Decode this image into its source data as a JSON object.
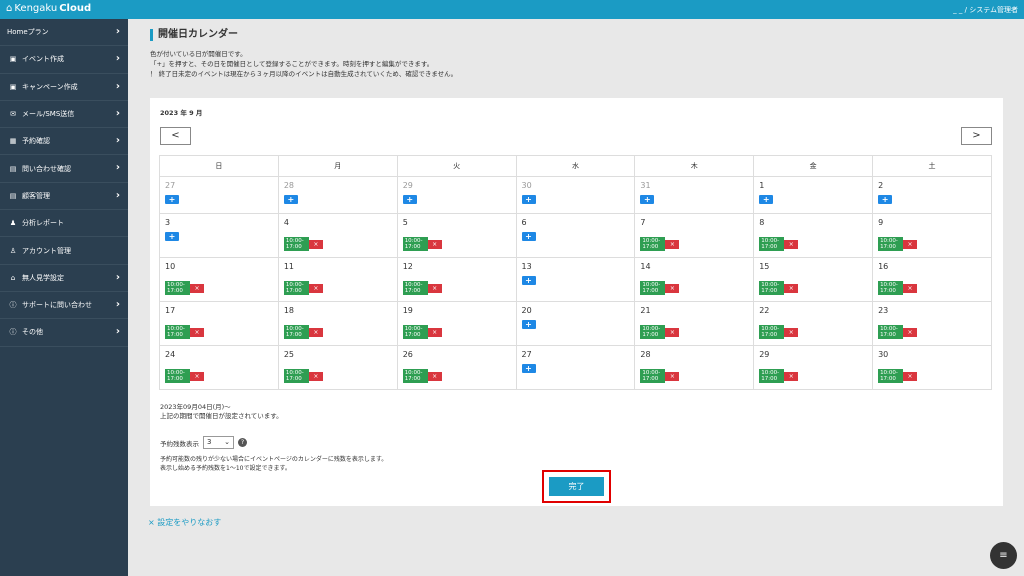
{
  "app": {
    "logo_a": "Kengaku",
    "logo_b": "Cloud",
    "user": "_ _ / システム管理者"
  },
  "sidebar": {
    "items": [
      {
        "label": "Homeプラン",
        "icon": "",
        "chev": true
      },
      {
        "label": "イベント作成",
        "icon": "image-icon",
        "chev": true
      },
      {
        "label": "キャンペーン作成",
        "icon": "image-icon",
        "chev": true
      },
      {
        "label": "メール/SMS送信",
        "icon": "mail-icon",
        "chev": true
      },
      {
        "label": "予約確認",
        "icon": "calendar-icon",
        "chev": true
      },
      {
        "label": "問い合わせ確認",
        "icon": "card-icon",
        "chev": true
      },
      {
        "label": "顧客管理",
        "icon": "card-icon",
        "chev": true
      },
      {
        "label": "分析レポート",
        "icon": "users-icon",
        "chev": false
      },
      {
        "label": "アカウント管理",
        "icon": "user-gear-icon",
        "chev": false
      },
      {
        "label": "無人見学設定",
        "icon": "home-icon",
        "chev": true
      },
      {
        "label": "サポートに問い合わせ",
        "icon": "info-icon",
        "chev": true
      },
      {
        "label": "その他",
        "icon": "info-icon",
        "chev": true
      }
    ]
  },
  "page": {
    "title": "開催日カレンダー",
    "desc": [
      "色が付いている日が開催日です。",
      "「+」を押すと、その日を開催日として登録することができます。時刻を押すと編集ができます。",
      "！ 終了日未定のイベントは現在から３ヶ月以降のイベントは自動生成されていくため、確認できません。"
    ]
  },
  "calendar": {
    "year_month": "2023 年 9 月",
    "prev": "<",
    "next": ">",
    "weekdays": [
      "日",
      "月",
      "火",
      "水",
      "木",
      "金",
      "土"
    ],
    "slot_time": [
      "10:00-",
      "17:00"
    ],
    "del": "×",
    "plus": "+",
    "rows": [
      [
        {
          "d": "27",
          "o": true,
          "t": "p"
        },
        {
          "d": "28",
          "o": true,
          "t": "p"
        },
        {
          "d": "29",
          "o": true,
          "t": "p"
        },
        {
          "d": "30",
          "o": true,
          "t": "p"
        },
        {
          "d": "31",
          "o": true,
          "t": "p"
        },
        {
          "d": "1",
          "t": "p"
        },
        {
          "d": "2",
          "t": "p"
        }
      ],
      [
        {
          "d": "3",
          "t": "p"
        },
        {
          "d": "4",
          "t": "s"
        },
        {
          "d": "5",
          "t": "s"
        },
        {
          "d": "6",
          "t": "p"
        },
        {
          "d": "7",
          "t": "s"
        },
        {
          "d": "8",
          "t": "s"
        },
        {
          "d": "9",
          "t": "s"
        }
      ],
      [
        {
          "d": "10",
          "t": "s"
        },
        {
          "d": "11",
          "t": "s"
        },
        {
          "d": "12",
          "t": "s"
        },
        {
          "d": "13",
          "t": "p"
        },
        {
          "d": "14",
          "t": "s"
        },
        {
          "d": "15",
          "t": "s"
        },
        {
          "d": "16",
          "t": "s"
        }
      ],
      [
        {
          "d": "17",
          "t": "s"
        },
        {
          "d": "18",
          "t": "s"
        },
        {
          "d": "19",
          "t": "s"
        },
        {
          "d": "20",
          "t": "p"
        },
        {
          "d": "21",
          "t": "s"
        },
        {
          "d": "22",
          "t": "s"
        },
        {
          "d": "23",
          "t": "s"
        }
      ],
      [
        {
          "d": "24",
          "t": "s"
        },
        {
          "d": "25",
          "t": "s"
        },
        {
          "d": "26",
          "t": "s"
        },
        {
          "d": "27",
          "t": "p"
        },
        {
          "d": "28",
          "t": "s"
        },
        {
          "d": "29",
          "t": "s"
        },
        {
          "d": "30",
          "t": "s"
        }
      ]
    ]
  },
  "period": {
    "line1": "2023年09月04日(月)〜",
    "line2": "上記の期間で開催日が設定されています。"
  },
  "remaining": {
    "label": "予約残数表示",
    "value": "3",
    "help": "?",
    "note1": "予約可能数の残りが少ない場合にイベントページのカレンダーに残数を表示します。",
    "note2": "表示し始める予約残数を1〜10で設定できます。"
  },
  "actions": {
    "done": "完了",
    "reset": "× 設定をやりなおす"
  },
  "colors": {
    "header": "#1b9bc4",
    "sidebar": "#2b3f50",
    "plus": "#1e88e5",
    "slot": "#2e9e52",
    "delete": "#d9363e",
    "highlight": "#e00000"
  }
}
